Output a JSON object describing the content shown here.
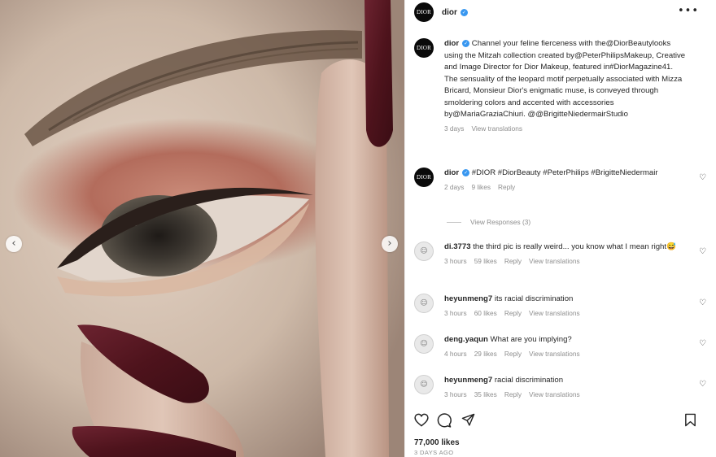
{
  "post": {
    "username": "dior",
    "avatar_text": "DIOR",
    "more_icon": "more-horizontal-icon",
    "prev_icon": "chevron-left-icon",
    "next_icon": "chevron-right-icon",
    "prev_glyph": "‹",
    "next_glyph": "›"
  },
  "caption": {
    "username": "dior",
    "text": "Channel your feline fierceness with the@DiorBeautylooks using the Mitzah collection created by@PeterPhilipsMakeup, Creative and Image Director for Dior Makeup, featured in#DiorMagazine41. The sensuality of the leopard motif perpetually associated with Mizza Bricard, Monsieur Dior's enigmatic muse, is conveyed through smoldering colors and accented with accessories by@MariaGraziaChiuri. @@BrigitteNiedermairStudio",
    "time": "3 days",
    "translate": "View translations"
  },
  "comments": [
    {
      "username": "dior",
      "text": "#DIOR #DiorBeauty #PeterPhilips #BrigitteNiedermair",
      "time": "2 days",
      "likes": "9 likes",
      "reply": "Reply",
      "translate": ""
    },
    {
      "username": "di.3773",
      "text": "the third pic is really weird... you know what I mean right😅",
      "time": "3 hours",
      "likes": "59 likes",
      "reply": "Reply",
      "translate": "View translations"
    },
    {
      "username": "heyunmeng7",
      "text": "its racial discrimination",
      "time": "3 hours",
      "likes": "60 likes",
      "reply": "Reply",
      "translate": "View translations"
    },
    {
      "username": "deng.yaqun",
      "text": "What are you implying?",
      "time": "4 hours",
      "likes": "29 likes",
      "reply": "Reply",
      "translate": "View translations"
    },
    {
      "username": "heyunmeng7",
      "text": "racial discrimination",
      "time": "3 hours",
      "likes": "35 likes",
      "reply": "Reply",
      "translate": "View translations"
    }
  ],
  "view_responses": "View Responses (3)",
  "footer": {
    "likes": "77,000 likes",
    "date": "3 DAYS AGO",
    "icons": [
      "heart-icon",
      "comment-icon",
      "share-icon",
      "bookmark-icon"
    ]
  },
  "colors": {
    "verified": "#3897f0",
    "muted_text": "#8e8e8e",
    "nail": "#5a1822",
    "eyeshadow": "#b0665a"
  }
}
